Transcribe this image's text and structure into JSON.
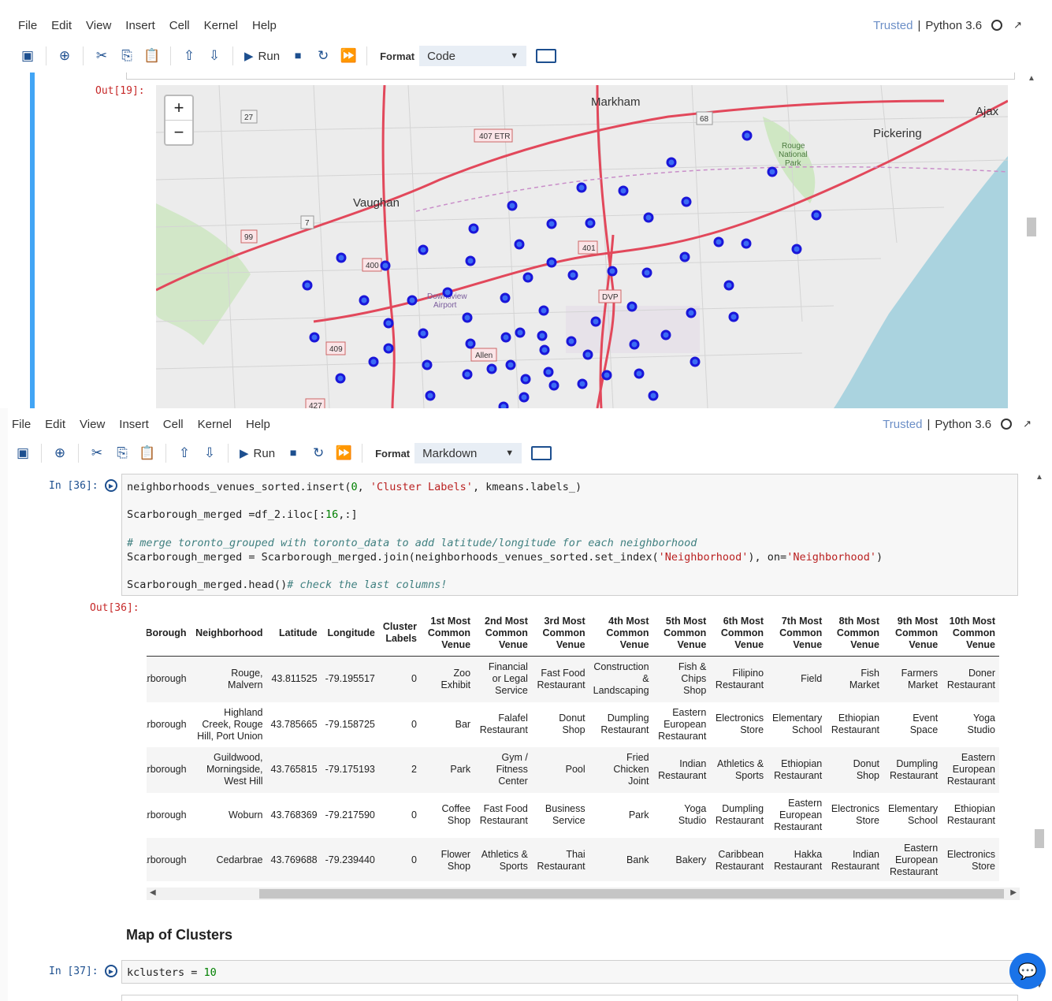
{
  "menus": [
    "File",
    "Edit",
    "View",
    "Insert",
    "Cell",
    "Kernel",
    "Help"
  ],
  "status": {
    "trusted": "Trusted",
    "kernel": "Python 3.6"
  },
  "toolbar": {
    "run_label": "Run",
    "format_label": "Format"
  },
  "top_pane": {
    "cell_type": "Code",
    "out_prompt": "Out[19]:",
    "map": {
      "zoom_in": "+",
      "zoom_out": "−",
      "places": [
        "Markham",
        "Vaughan",
        "Pickering",
        "Ajax",
        "Rouge National Park",
        "Downsview Airport",
        "Allen",
        "DVP",
        "407 ETR",
        "401",
        "400",
        "409",
        "427",
        "99",
        "27",
        "7",
        "68"
      ],
      "marker_color": "#1a16d9"
    }
  },
  "bottom_pane": {
    "cell_type": "Markdown",
    "in_prompt_36": "In [36]:",
    "out_prompt_36": "Out[36]:",
    "in_prompt_37": "In [37]:",
    "heading": "Map of Clusters"
  },
  "table": {
    "columns": [
      "Borough",
      "Neighborhood",
      "Latitude",
      "Longitude",
      "Cluster Labels",
      "1st Most Common Venue",
      "2nd Most Common Venue",
      "3rd Most Common Venue",
      "4th Most Common Venue",
      "5th Most Common Venue",
      "6th Most Common Venue",
      "7th Most Common Venue",
      "8th Most Common Venue",
      "9th Most Common Venue",
      "10th Most Common Venue"
    ],
    "rows": [
      [
        "Scarborough",
        "Rouge, Malvern",
        "43.811525",
        "-79.195517",
        "0",
        "Zoo Exhibit",
        "Financial or Legal Service",
        "Fast Food Restaurant",
        "Construction & Landscaping",
        "Fish & Chips Shop",
        "Filipino Restaurant",
        "Field",
        "Fish Market",
        "Farmers Market",
        "Doner Restaurant"
      ],
      [
        "Scarborough",
        "Highland Creek, Rouge Hill, Port Union",
        "43.785665",
        "-79.158725",
        "0",
        "Bar",
        "Falafel Restaurant",
        "Donut Shop",
        "Dumpling Restaurant",
        "Eastern European Restaurant",
        "Electronics Store",
        "Elementary School",
        "Ethiopian Restaurant",
        "Event Space",
        "Yoga Studio"
      ],
      [
        "Scarborough",
        "Guildwood, Morningside, West Hill",
        "43.765815",
        "-79.175193",
        "2",
        "Park",
        "Gym / Fitness Center",
        "Pool",
        "Fried Chicken Joint",
        "Indian Restaurant",
        "Athletics & Sports",
        "Ethiopian Restaurant",
        "Donut Shop",
        "Dumpling Restaurant",
        "Eastern European Restaurant"
      ],
      [
        "Scarborough",
        "Woburn",
        "43.768369",
        "-79.217590",
        "0",
        "Coffee Shop",
        "Fast Food Restaurant",
        "Business Service",
        "Park",
        "Yoga Studio",
        "Dumpling Restaurant",
        "Eastern European Restaurant",
        "Electronics Store",
        "Elementary School",
        "Ethiopian Restaurant"
      ],
      [
        "Scarborough",
        "Cedarbrae",
        "43.769688",
        "-79.239440",
        "0",
        "Flower Shop",
        "Athletics & Sports",
        "Thai Restaurant",
        "Bank",
        "Bakery",
        "Caribbean Restaurant",
        "Hakka Restaurant",
        "Indian Restaurant",
        "Eastern European Restaurant",
        "Electronics Store"
      ]
    ]
  }
}
